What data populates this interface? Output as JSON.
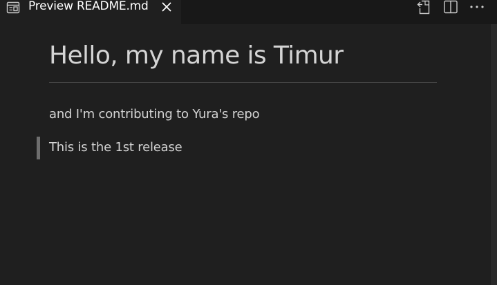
{
  "tab": {
    "label": "Preview README.md",
    "icon": "preview-icon",
    "close_icon": "close-icon"
  },
  "actions": [
    {
      "icon": "open-source-icon"
    },
    {
      "icon": "split-editor-icon"
    },
    {
      "icon": "more-actions-icon"
    }
  ],
  "document": {
    "heading": "Hello, my name is Timur",
    "paragraph": "and I'm contributing to Yura's repo",
    "blockquote": "This is the 1st release"
  },
  "colors": {
    "editor_background": "#1f1f1f",
    "tab_bar_background": "#181818",
    "text": "#d4d4d4",
    "blockquote_bar": "#6e6e6e"
  }
}
